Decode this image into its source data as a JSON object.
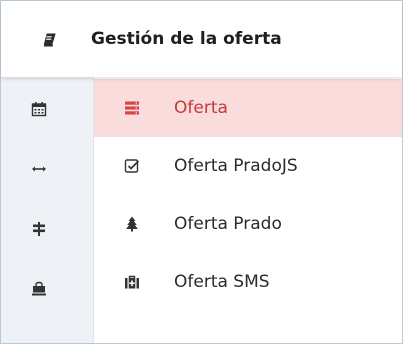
{
  "header": {
    "title": "Gestión de la oferta",
    "icon": "book-icon"
  },
  "rail": [
    {
      "icon": "calendar-icon"
    },
    {
      "icon": "arrows-horizontal-icon"
    },
    {
      "icon": "signpost-icon"
    },
    {
      "icon": "bag-icon"
    }
  ],
  "menu": [
    {
      "label": "Oferta",
      "icon": "server-list-icon",
      "active": true
    },
    {
      "label": "Oferta PradoJS",
      "icon": "checkbox-icon",
      "active": false
    },
    {
      "label": "Oferta Prado",
      "icon": "tree-icon",
      "active": false
    },
    {
      "label": "Oferta SMS",
      "icon": "medkit-icon",
      "active": false
    }
  ],
  "colors": {
    "accent": "#c23a3a",
    "active_bg": "#fbdcdc",
    "rail_bg": "#eef1f6"
  }
}
